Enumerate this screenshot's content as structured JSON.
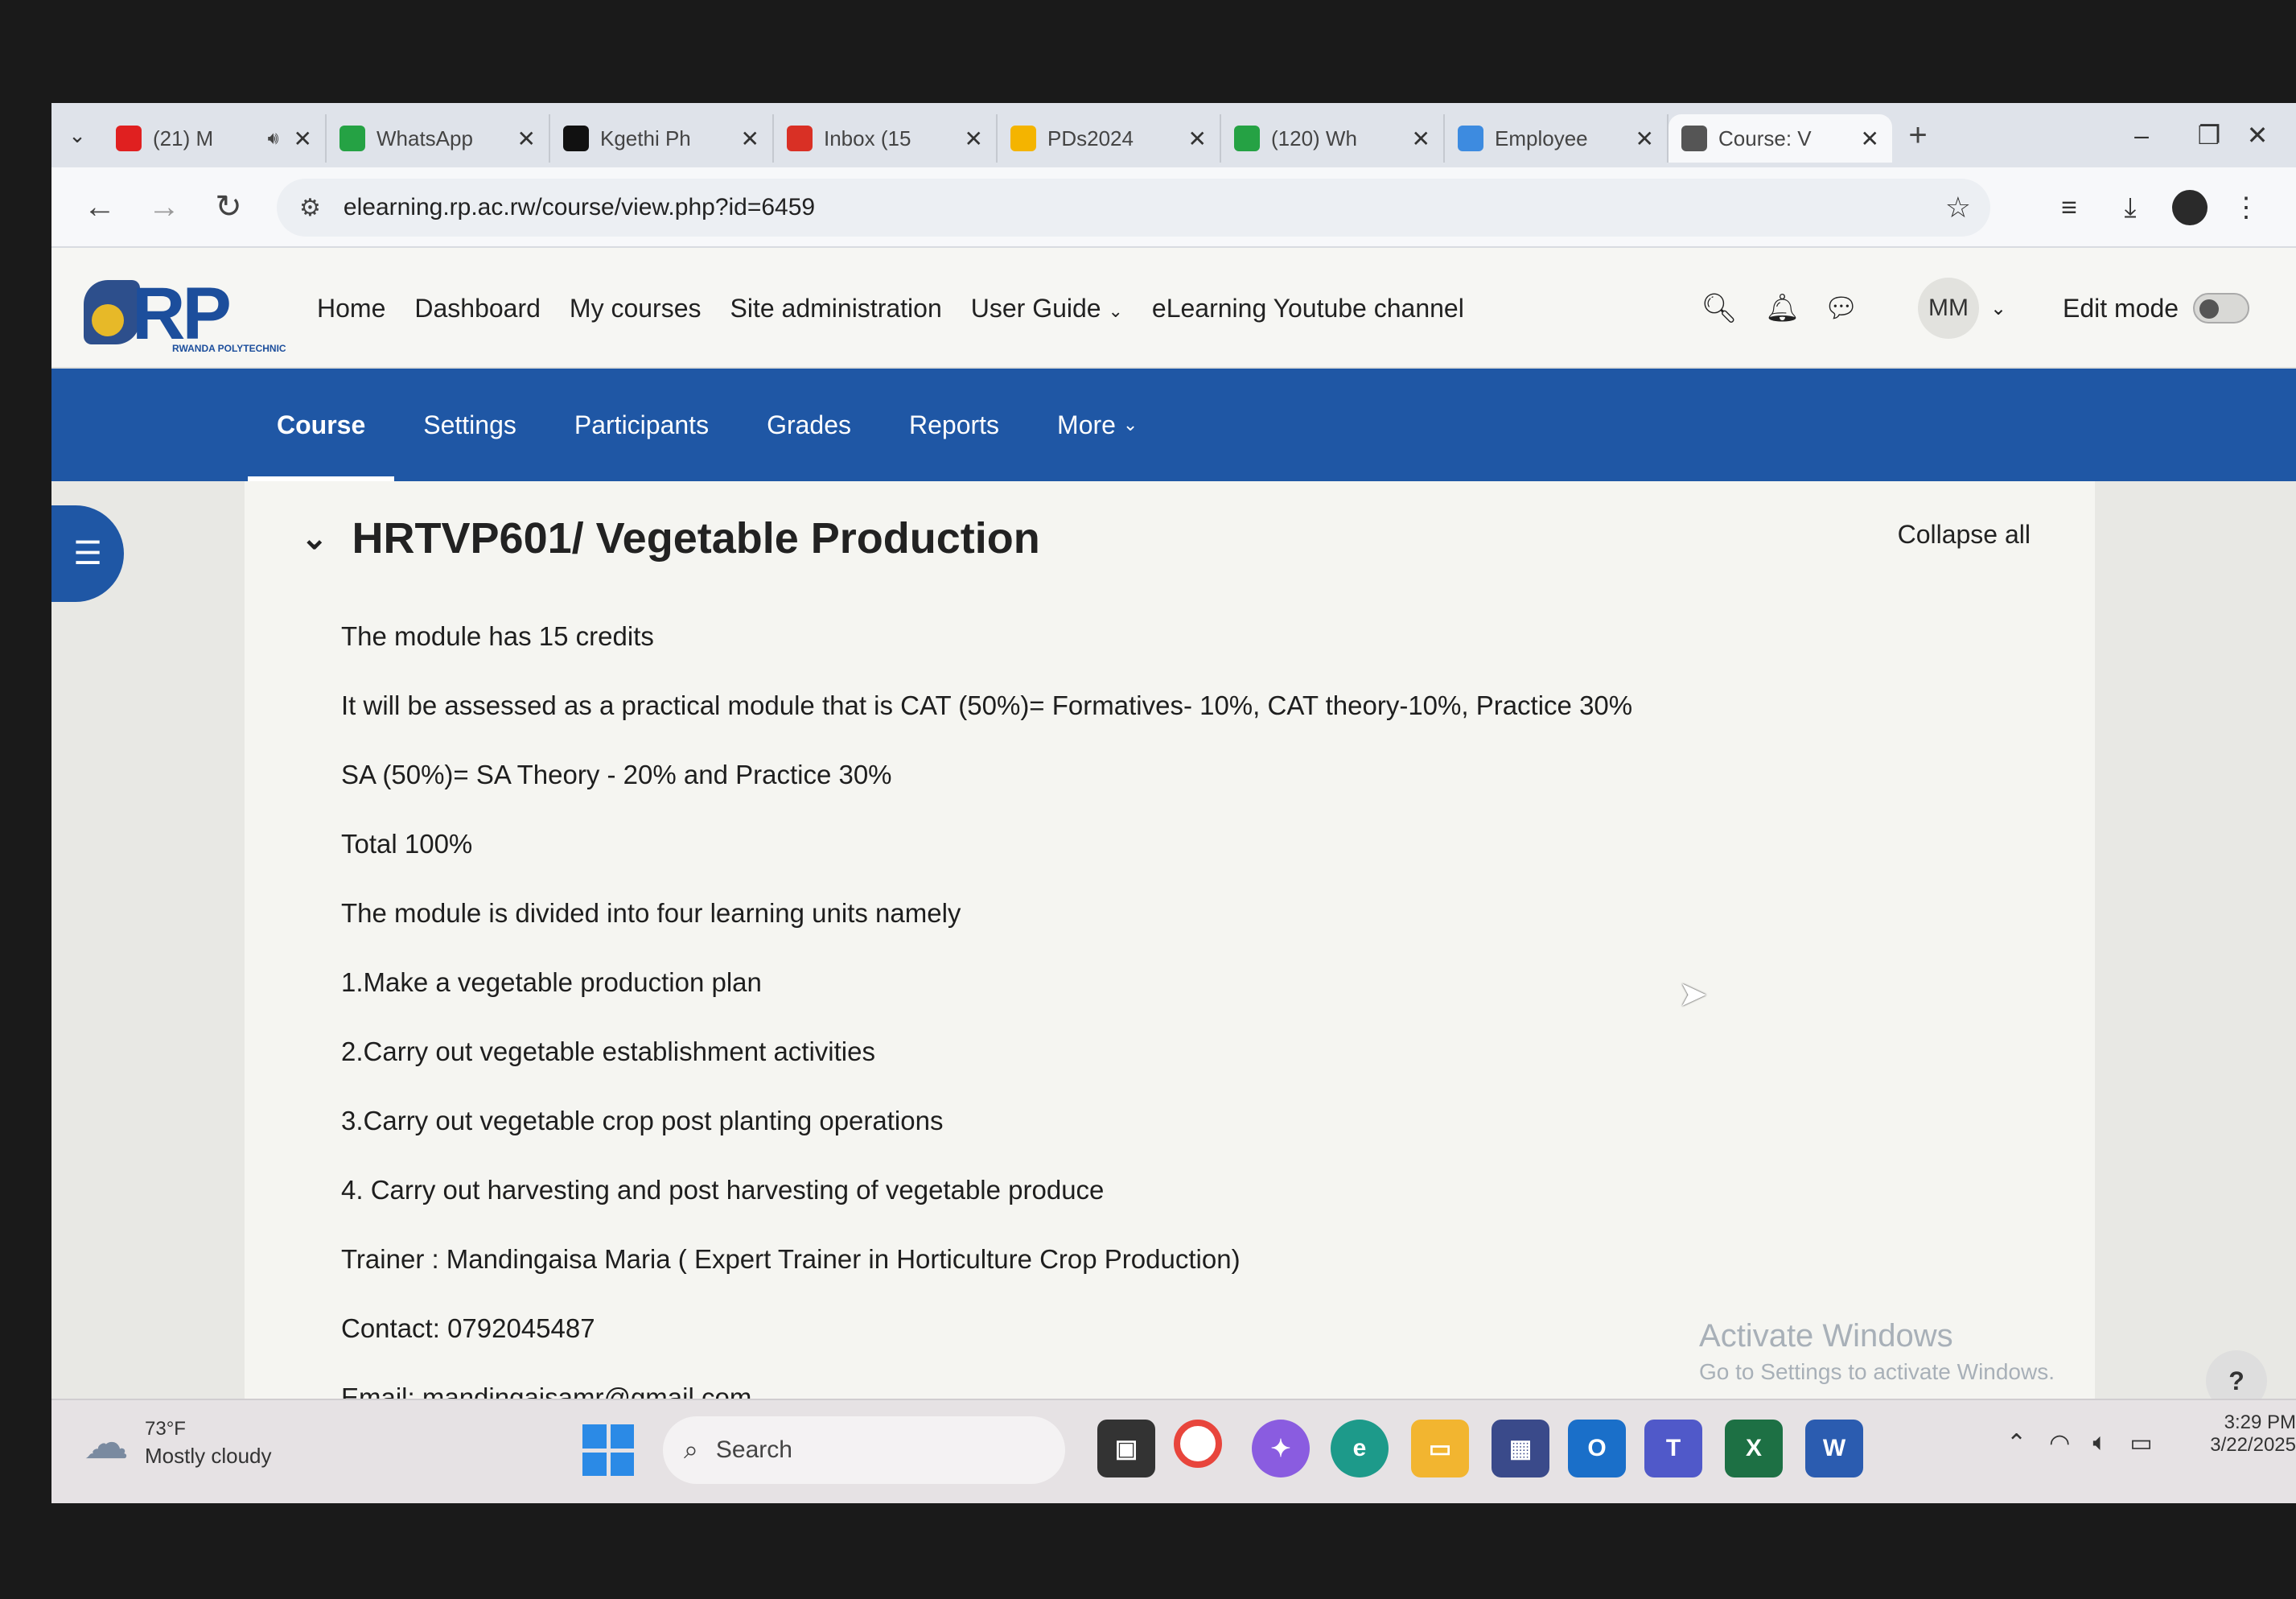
{
  "browser": {
    "tabs": [
      {
        "title": "(21) M",
        "icon": "youtube-icon",
        "color": "#e02020",
        "audio": true
      },
      {
        "title": "WhatsApp",
        "icon": "whatsapp-icon",
        "color": "#25a244"
      },
      {
        "title": "Kgethi Ph",
        "icon": "x-icon",
        "color": "#111111"
      },
      {
        "title": "Inbox (15",
        "icon": "gmail-icon",
        "color": "#d93025"
      },
      {
        "title": "PDs2024",
        "icon": "drive-icon",
        "color": "#f4b400"
      },
      {
        "title": "(120) Wh",
        "icon": "whatsapp-icon",
        "color": "#25a244"
      },
      {
        "title": "Employee",
        "icon": "globe-icon",
        "color": "#3d8be0"
      },
      {
        "title": "Course: V",
        "icon": "globe-icon",
        "color": "#555555",
        "active": true
      }
    ],
    "url": "elearning.rp.ac.rw/course/view.php?id=6459"
  },
  "site": {
    "logo_text": "RP",
    "logo_sub": "RWANDA POLYTECHNIC",
    "nav": [
      "Home",
      "Dashboard",
      "My courses",
      "Site administration",
      "User Guide",
      "eLearning Youtube channel"
    ],
    "user_initials": "MM",
    "edit_mode_label": "Edit mode",
    "edit_mode_on": false
  },
  "course_nav": {
    "items": [
      "Course",
      "Settings",
      "Participants",
      "Grades",
      "Reports",
      "More"
    ],
    "active": "Course"
  },
  "section": {
    "title": "HRTVP601/ Vegetable Production",
    "collapse_label": "Collapse all",
    "summary": [
      " The module has 15 credits",
      "It will be assessed as  a practical module that is CAT (50%)= Formatives- 10%, CAT theory-10%, Practice 30%",
      "SA (50%)= SA Theory - 20% and Practice 30%",
      "Total 100%",
      "The module is divided into four learning units namely",
      "1.Make a vegetable production plan",
      "2.Carry out vegetable establishment activities",
      "3.Carry out vegetable crop post planting operations",
      "4. Carry out harvesting and post harvesting of vegetable produce",
      "Trainer : Mandingaisa Maria ( Expert Trainer in Horticulture Crop Production)",
      "Contact: 0792045487",
      "Email: mandingaisamr@gmail.com"
    ]
  },
  "watermark": {
    "line1": "Activate Windows",
    "line2": "Go to Settings to activate Windows."
  },
  "help_label": "?",
  "taskbar": {
    "weather_temp": "73°F",
    "weather_cond": "Mostly cloudy",
    "search_placeholder": "Search",
    "time": "3:29 PM",
    "date": "3/22/2025"
  }
}
